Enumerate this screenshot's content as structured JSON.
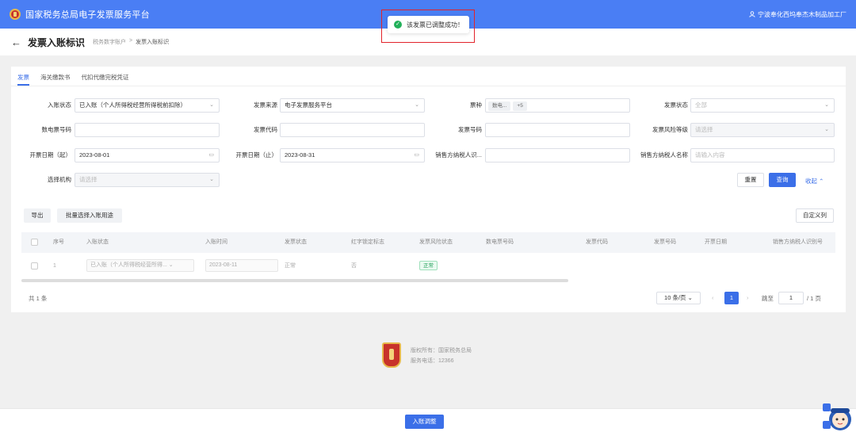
{
  "header": {
    "brand": "国家税务总局电子发票服务平台",
    "user": "宁波奉化西坞奉杰木制品加工厂"
  },
  "toast": {
    "message": "该发票已调整成功！"
  },
  "title_bar": {
    "title": "发票入账标识",
    "breadcrumb": [
      "税务数字账户",
      "发票入账标识"
    ]
  },
  "tabs": [
    {
      "label": "发票",
      "active": true
    },
    {
      "label": "海关缴款书",
      "active": false
    },
    {
      "label": "代扣代缴完税凭证",
      "active": false
    }
  ],
  "filters": {
    "account_status": {
      "label": "入账状态",
      "value": "已入账（个人所得税经营所得税前扣除）"
    },
    "source": {
      "label": "发票来源",
      "value": "电子发票服务平台"
    },
    "ticket_type": {
      "label": "票种",
      "tags": [
        "数电...",
        "+5"
      ]
    },
    "invoice_status": {
      "label": "发票状态",
      "value": "全部"
    },
    "digital_no": {
      "label": "数电票号码",
      "value": ""
    },
    "invoice_code": {
      "label": "发票代码",
      "value": ""
    },
    "invoice_no": {
      "label": "发票号码",
      "value": ""
    },
    "risk_level": {
      "label": "发票风险等级",
      "placeholder": "请选择"
    },
    "date_start": {
      "label": "开票日期（起）",
      "value": "2023-08-01"
    },
    "date_end": {
      "label": "开票日期（止）",
      "value": "2023-08-31"
    },
    "seller_tax_id": {
      "label": "销售方纳税人识...",
      "value": ""
    },
    "seller_name": {
      "label": "销售方纳税人名称",
      "placeholder": "请输入内容"
    },
    "org": {
      "label": "选择机构",
      "placeholder": "请选择"
    }
  },
  "actions": {
    "reset": "重置",
    "query": "查询",
    "collapse": "收起 ⌃",
    "export": "导出",
    "batch": "批量选择入账用途",
    "custom_columns": "自定义列"
  },
  "table": {
    "headers": [
      "序号",
      "入账状态",
      "入账时间",
      "发票状态",
      "红字锁定标志",
      "发票风险状态",
      "数电票号码",
      "发票代码",
      "发票号码",
      "开票日期",
      "销售方纳税人识别号"
    ],
    "rows": [
      {
        "index": "1",
        "account_status": "已入账（个人所得税经营所得...",
        "account_time": "2023-08-11",
        "invoice_status": "正常",
        "red_lock": "否",
        "risk_status": "正常"
      }
    ]
  },
  "pagination": {
    "total": "共 1 条",
    "page_size": "10 条/页",
    "current": "1",
    "jump_label": "跳至",
    "jump_value": "1",
    "pages": "/ 1 页"
  },
  "footer": {
    "copyright": "版权所有：国家税务总局",
    "phone": "服务电话：12366"
  },
  "bottom": {
    "adjust": "入账调整"
  }
}
